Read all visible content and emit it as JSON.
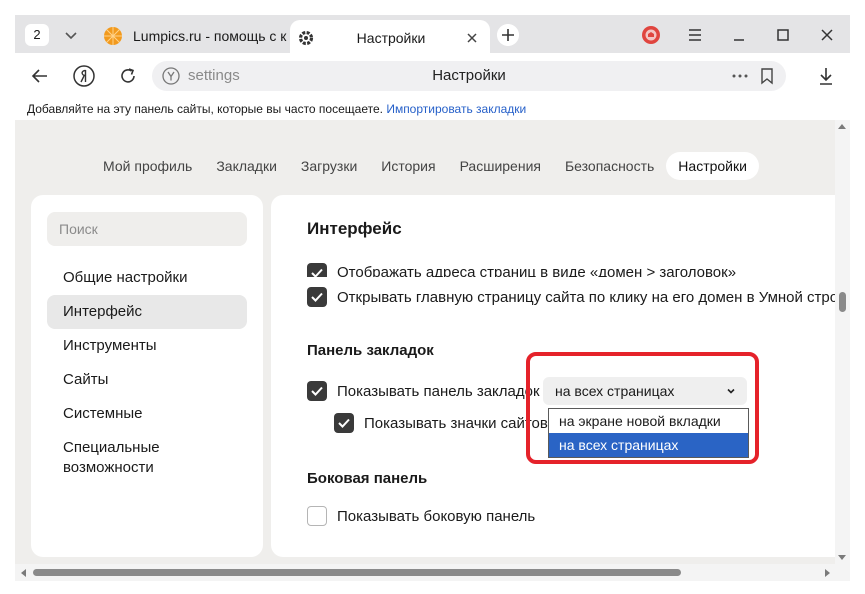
{
  "tabstrip": {
    "tab_count": "2",
    "tabs": [
      {
        "title": "Lumpics.ru - помощь с компьютером",
        "favicon": "orange-circle-favicon"
      },
      {
        "title": "Настройки",
        "favicon": "gear-icon"
      }
    ]
  },
  "address_bar": {
    "url_text": "settings",
    "page_title": "Настройки"
  },
  "bookmarks_bar": {
    "prompt": "Добавляйте на эту панель сайты, которые вы часто посещаете. ",
    "import_link": "Импортировать закладки"
  },
  "settings_nav": {
    "items": [
      "Мой профиль",
      "Закладки",
      "Загрузки",
      "История",
      "Расширения",
      "Безопасность",
      "Настройки"
    ],
    "active_index": 6
  },
  "sidebar": {
    "search_placeholder": "Поиск",
    "items": [
      {
        "label": "Общие настройки"
      },
      {
        "label": "Интерфейс"
      },
      {
        "label": "Инструменты"
      },
      {
        "label": "Сайты"
      },
      {
        "label": "Системные"
      },
      {
        "label": "Специальные возможности"
      }
    ],
    "active_index": 1
  },
  "content": {
    "section_title": "Интерфейс",
    "options": {
      "address_format": {
        "label": "Отображать адреса страниц в виде «домен > заголовок»",
        "checked": true
      },
      "open_home_by_domain": {
        "label": "Открывать главную страницу сайта по клику на его домен в Умной строке",
        "checked": true
      }
    },
    "bookmarks_panel": {
      "title": "Панель закладок",
      "show_panel": {
        "label": "Показывать панель закладок",
        "checked": true
      },
      "show_icons": {
        "label": "Показывать значки сайтов",
        "checked": true
      },
      "select_value": "на всех страницах",
      "dropdown_options": [
        "на экране новой вкладки",
        "на всех страницах"
      ],
      "dropdown_selected_index": 1
    },
    "side_panel": {
      "title": "Боковая панель",
      "show_side_panel": {
        "label": "Показывать боковую панель",
        "checked": false
      }
    }
  },
  "colors": {
    "accent_link": "#2660c9",
    "dropdown_selection": "#2a64c5",
    "highlight_frame": "#e5222a"
  }
}
